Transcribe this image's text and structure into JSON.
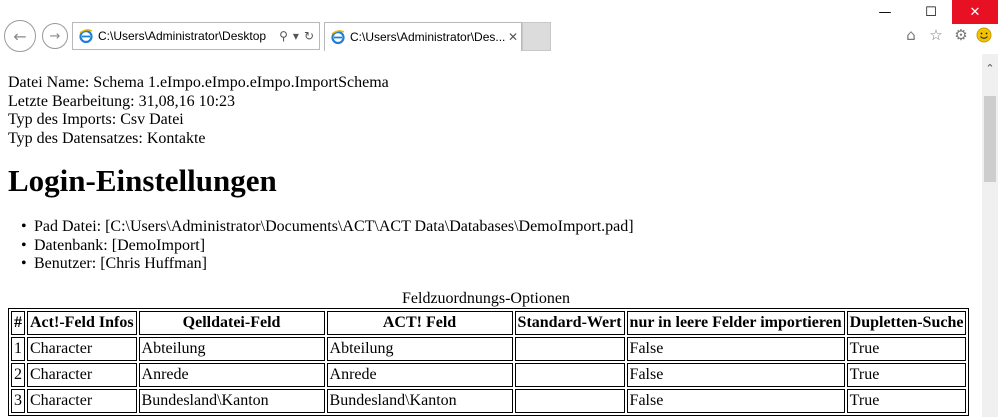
{
  "browser": {
    "address": "C:\\Users\\Administrator\\Desktop",
    "tab_title": "C:\\Users\\Administrator\\Des...",
    "icons": [
      "back-icon",
      "forward-icon",
      "search-icon",
      "dropdown-icon",
      "refresh-icon",
      "home-icon",
      "favorites-star-icon",
      "settings-gear-icon",
      "smiley-feedback-icon"
    ],
    "close_button_color": "#e81123"
  },
  "meta": {
    "file_name": "Datei Name: Schema 1.eImpo.eImpo.eImpo.ImportSchema",
    "last_edit": "Letzte Bearbeitung: 31,08,16 10:23",
    "import_type": "Typ des Imports: Csv Datei",
    "record_type": "Typ des Datensatzes: Kontakte"
  },
  "heading": "Login-Einstellungen",
  "login": {
    "pad_file": "Pad Datei: [C:\\Users\\Administrator\\Documents\\ACT\\ACT Data\\Databases\\DemoImport.pad]",
    "database": "Datenbank: [DemoImport]",
    "user": "Benutzer: [Chris Huffman]"
  },
  "table": {
    "caption": "Feldzuordnungs-Optionen",
    "headers": [
      "#",
      "Act!-Feld Infos",
      "Qelldatei-Feld",
      "ACT! Feld",
      "Standard-Wert",
      "nur in leere Felder importieren",
      "Dupletten-Suche"
    ],
    "rows": [
      [
        "1",
        "Character",
        "Abteilung",
        "Abteilung",
        "",
        "False",
        "True"
      ],
      [
        "2",
        "Character",
        "Anrede",
        "Anrede",
        "",
        "False",
        "True"
      ],
      [
        "3",
        "Character",
        "Bundesland\\Kanton",
        "Bundesland\\Kanton",
        "",
        "False",
        "True"
      ]
    ]
  }
}
